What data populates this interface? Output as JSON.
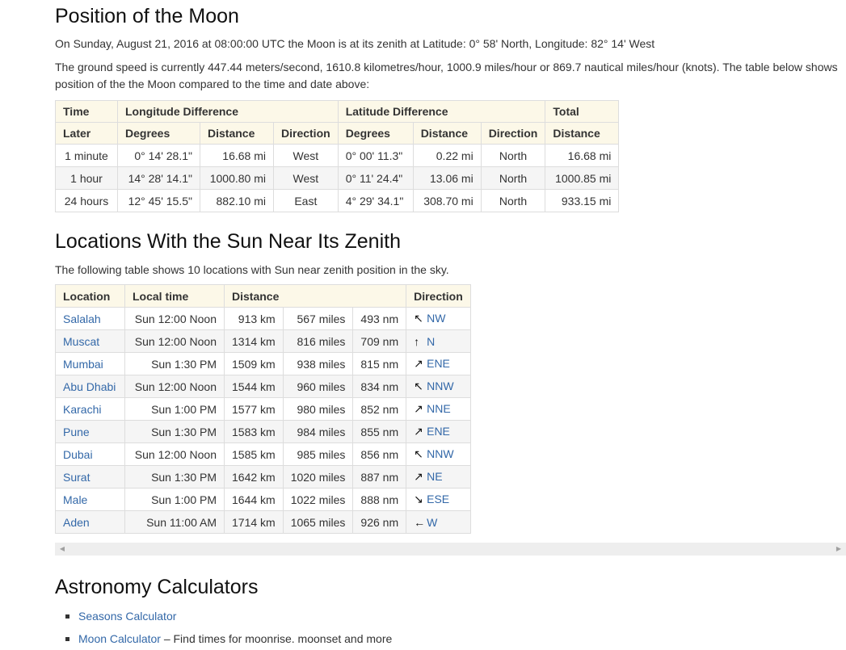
{
  "moon_section": {
    "title": "Position of the Moon",
    "zenith_text": "On Sunday, August 21, 2016 at 08:00:00 UTC the Moon is at its zenith at Latitude: 0° 58' North, Longitude: 82° 14' West",
    "speed_text": "The ground speed is currently 447.44 meters/second, 1610.8 kilometres/hour, 1000.9 miles/hour or 869.7 nautical miles/hour (knots). The table below shows position of the the Moon compared to the time and date above:",
    "table": {
      "group_headers": [
        "Time",
        "Longitude Difference",
        "Latitude Difference",
        "Total"
      ],
      "sub_headers": [
        "Later",
        "Degrees",
        "Distance",
        "Direction",
        "Degrees",
        "Distance",
        "Direction",
        "Distance"
      ],
      "rows": [
        [
          "1 minute",
          "0° 14' 28.1\"",
          "16.68 mi",
          "West",
          "0° 00' 11.3\"",
          "0.22 mi",
          "North",
          "16.68 mi"
        ],
        [
          "1 hour",
          "14° 28' 14.1\"",
          "1000.80 mi",
          "West",
          "0° 11' 24.4\"",
          "13.06 mi",
          "North",
          "1000.85 mi"
        ],
        [
          "24 hours",
          "12° 45' 15.5\"",
          "882.10 mi",
          "East",
          "4° 29' 34.1\"",
          "308.70 mi",
          "North",
          "933.15 mi"
        ]
      ]
    }
  },
  "zenith_section": {
    "title": "Locations With the Sun Near Its Zenith",
    "description": "The following table shows 10 locations with Sun near zenith position in the sky.",
    "table": {
      "headers": [
        "Location",
        "Local time",
        "Distance",
        "Direction"
      ],
      "rows": [
        {
          "location": "Salalah",
          "time": "Sun 12:00 Noon",
          "km": "913 km",
          "miles": "567 miles",
          "nm": "493 nm",
          "arrow": "↖",
          "dir": "NW"
        },
        {
          "location": "Muscat",
          "time": "Sun 12:00 Noon",
          "km": "1314 km",
          "miles": "816 miles",
          "nm": "709 nm",
          "arrow": "↑",
          "dir": "N"
        },
        {
          "location": "Mumbai",
          "time": "Sun 1:30 PM",
          "km": "1509 km",
          "miles": "938 miles",
          "nm": "815 nm",
          "arrow": "↗",
          "dir": "ENE"
        },
        {
          "location": "Abu Dhabi",
          "time": "Sun 12:00 Noon",
          "km": "1544 km",
          "miles": "960 miles",
          "nm": "834 nm",
          "arrow": "↖",
          "dir": "NNW"
        },
        {
          "location": "Karachi",
          "time": "Sun 1:00 PM",
          "km": "1577 km",
          "miles": "980 miles",
          "nm": "852 nm",
          "arrow": "↗",
          "dir": "NNE"
        },
        {
          "location": "Pune",
          "time": "Sun 1:30 PM",
          "km": "1583 km",
          "miles": "984 miles",
          "nm": "855 nm",
          "arrow": "↗",
          "dir": "ENE"
        },
        {
          "location": "Dubai",
          "time": "Sun 12:00 Noon",
          "km": "1585 km",
          "miles": "985 miles",
          "nm": "856 nm",
          "arrow": "↖",
          "dir": "NNW"
        },
        {
          "location": "Surat",
          "time": "Sun 1:30 PM",
          "km": "1642 km",
          "miles": "1020 miles",
          "nm": "887 nm",
          "arrow": "↗",
          "dir": "NE"
        },
        {
          "location": "Male",
          "time": "Sun 1:00 PM",
          "km": "1644 km",
          "miles": "1022 miles",
          "nm": "888 nm",
          "arrow": "↘",
          "dir": "ESE"
        },
        {
          "location": "Aden",
          "time": "Sun 11:00 AM",
          "km": "1714 km",
          "miles": "1065 miles",
          "nm": "926 nm",
          "arrow": "←",
          "dir": "W"
        }
      ]
    }
  },
  "scrollbar": {
    "left_arrow": "◀",
    "right_arrow": "▶"
  },
  "calculators": {
    "title": "Astronomy Calculators",
    "items": [
      {
        "link": "Seasons Calculator",
        "description": ""
      },
      {
        "link": "Moon Calculator",
        "description": " – Find times for moonrise. moonset and more"
      }
    ]
  },
  "colors": {
    "link": "#3368a8",
    "header_bg": "#fcf8e8",
    "stripe_bg": "#f5f5f5",
    "border": "#dddddd"
  }
}
